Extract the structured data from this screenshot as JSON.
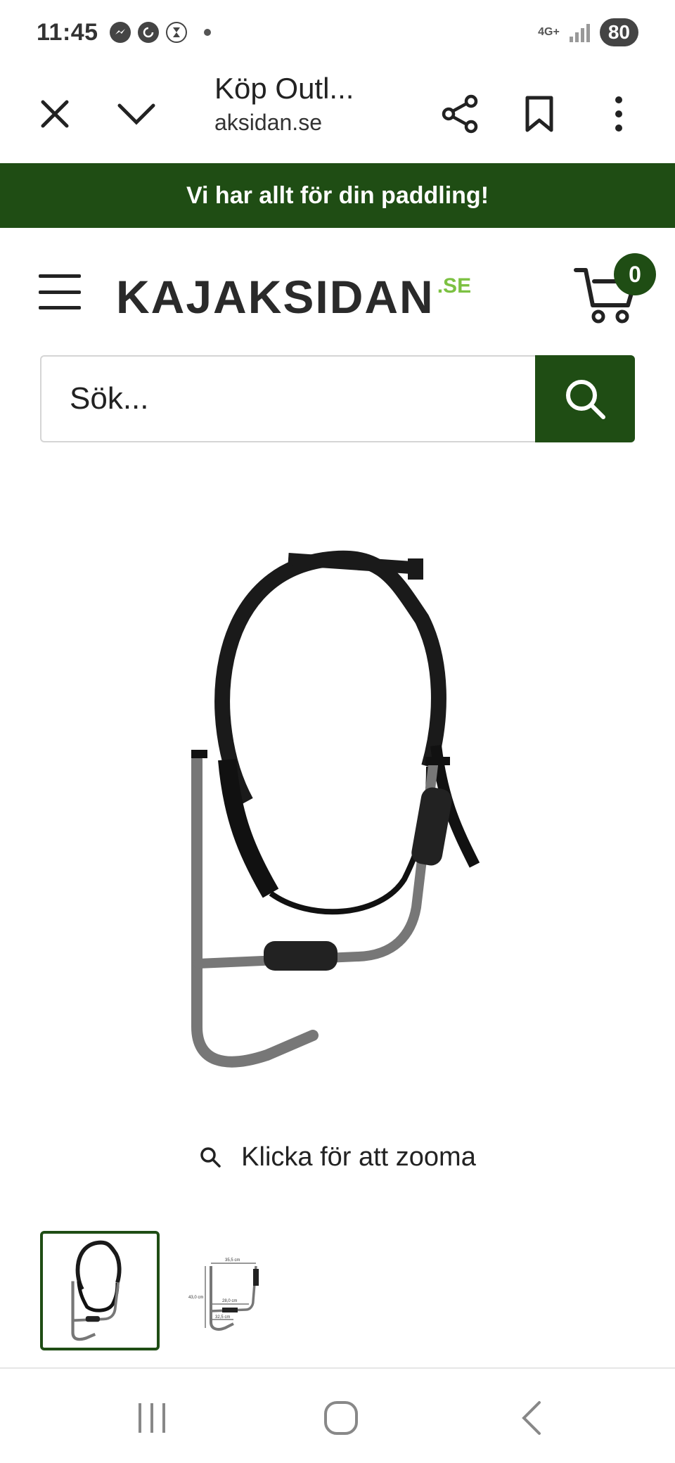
{
  "status_bar": {
    "time": "11:45",
    "network": "4G+",
    "battery": "80",
    "icons": [
      "messenger-icon",
      "sync-icon",
      "hourglass-icon",
      "dot-icon",
      "signal-icon",
      "battery-icon"
    ]
  },
  "browser": {
    "title": "Köp Outl...",
    "url": "aksidan.se",
    "icons": [
      "close-icon",
      "chevron-down-icon",
      "share-icon",
      "bookmark-icon",
      "more-vert-icon"
    ]
  },
  "promo": {
    "text": "Vi har allt för din paddling!"
  },
  "header": {
    "logo_main": "KAJAKSIDAN",
    "logo_suffix": ".SE",
    "cart_count": "0"
  },
  "search": {
    "placeholder": "Sök...",
    "value": ""
  },
  "product": {
    "zoom_label": "Klicka för att zooma",
    "thumbnails": [
      "thumb-1",
      "thumb-2"
    ],
    "thumb_dimensions": [
      "35,5 cm",
      "28,0 cm",
      "32,5 cm",
      "43,0 cm"
    ]
  },
  "colors": {
    "brand_green": "#1f4d14",
    "logo_accent": "#7cc142"
  }
}
